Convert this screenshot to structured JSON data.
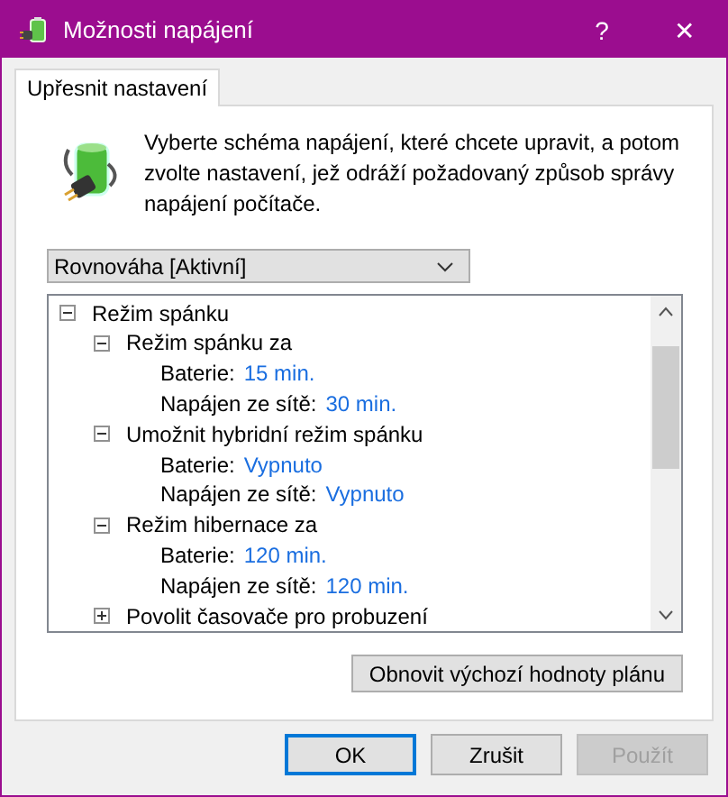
{
  "window": {
    "title": "Možnosti napájení",
    "help": "?",
    "close": "✕"
  },
  "tabs": [
    {
      "label": "Upřesnit nastavení",
      "selected": true
    }
  ],
  "description": "Vyberte schéma napájení, které chcete upravit, a potom zvolte nastavení, jež odráží požadovaný způsob správy napájení počítače.",
  "plan_dropdown": {
    "value": "Rovnováha [Aktivní]"
  },
  "settings_tree": [
    {
      "label": "Režim spánku",
      "expanded": true,
      "children": [
        {
          "label": "Režim spánku za",
          "expanded": true,
          "children": [
            {
              "label": "Baterie:",
              "value": "15 min."
            },
            {
              "label": "Napájen ze sítě:",
              "value": "30 min."
            }
          ]
        },
        {
          "label": "Umožnit hybridní režim spánku",
          "expanded": true,
          "children": [
            {
              "label": "Baterie:",
              "value": "Vypnuto"
            },
            {
              "label": "Napájen ze sítě:",
              "value": "Vypnuto"
            }
          ]
        },
        {
          "label": "Režim hibernace za",
          "expanded": true,
          "children": [
            {
              "label": "Baterie:",
              "value": "120 min."
            },
            {
              "label": "Napájen ze sítě:",
              "value": "120 min."
            }
          ]
        },
        {
          "label": "Povolit časovače pro probuzení",
          "expanded": false
        }
      ]
    }
  ],
  "restore_button": "Obnovit výchozí hodnoty plánu",
  "buttons": [
    {
      "label": "OK",
      "default": true,
      "disabled": false
    },
    {
      "label": "Zrušit",
      "default": false,
      "disabled": false
    },
    {
      "label": "Použít",
      "default": false,
      "disabled": true
    }
  ]
}
